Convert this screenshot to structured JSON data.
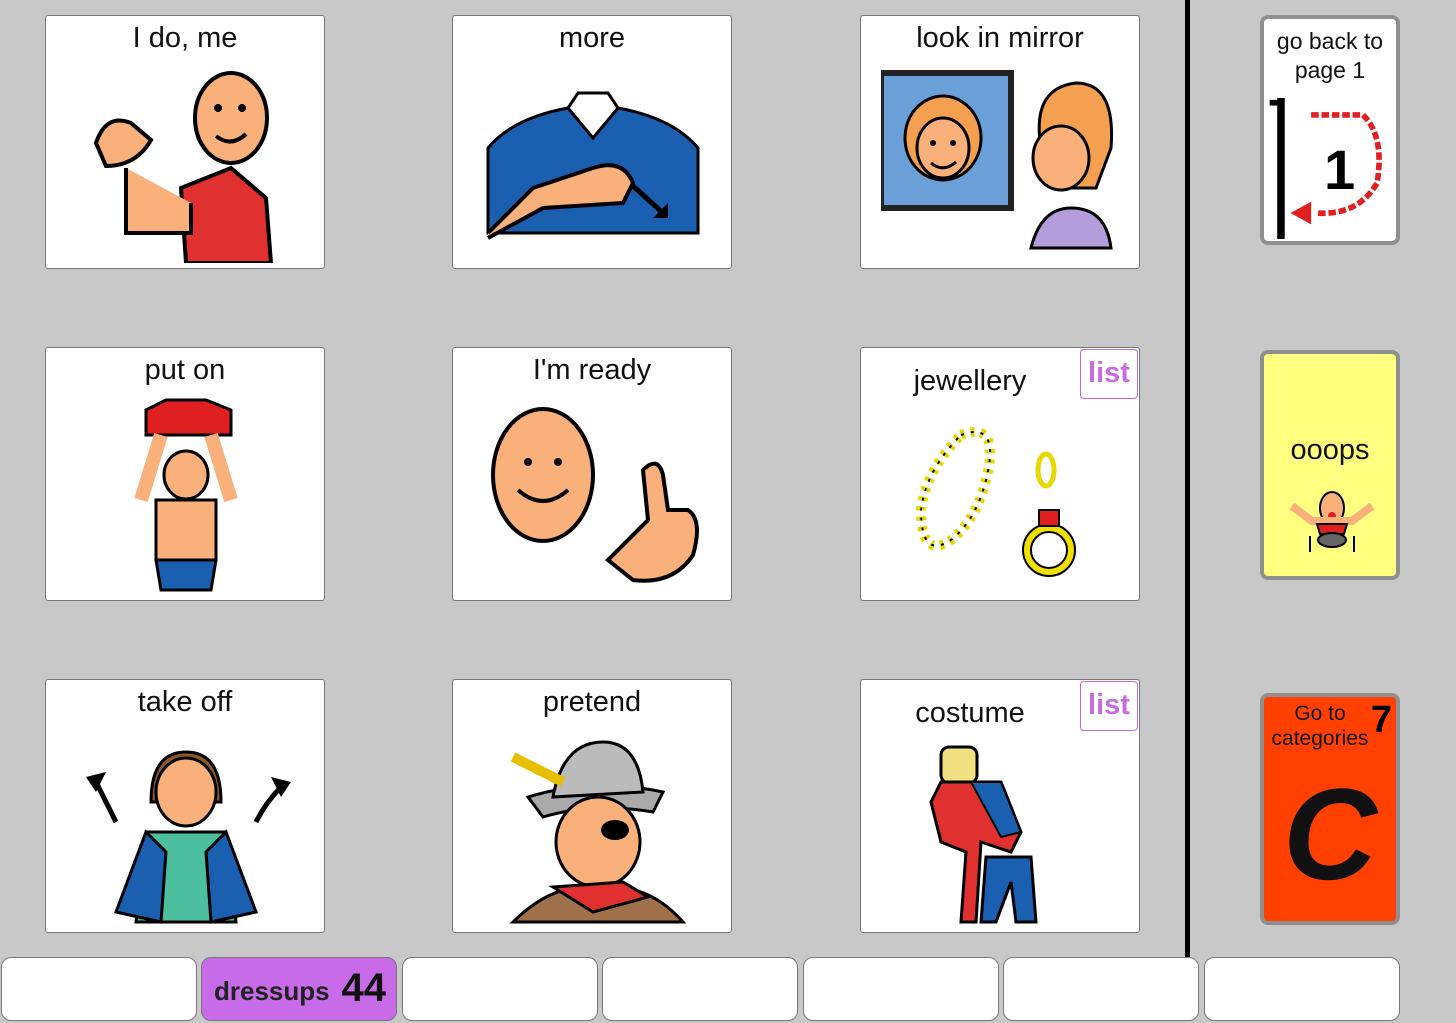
{
  "grid": [
    {
      "label": "I do, me",
      "list": ""
    },
    {
      "label": "more",
      "list": ""
    },
    {
      "label": "look in mirror",
      "list": ""
    },
    {
      "label": "put on",
      "list": ""
    },
    {
      "label": "I'm ready",
      "list": ""
    },
    {
      "label": "jewellery",
      "list": "list"
    },
    {
      "label": "take off",
      "list": ""
    },
    {
      "label": "pretend",
      "list": ""
    },
    {
      "label": "costume",
      "list": "list"
    }
  ],
  "side": {
    "back": {
      "label": "go back to page 1",
      "number": "1"
    },
    "oops": {
      "label": "ooops",
      "color": "#ffff80"
    },
    "categories": {
      "label": "Go to categories",
      "number": "7",
      "letter": "C",
      "color": "#ff4000"
    }
  },
  "bottom_tabs": [
    {
      "label": "",
      "count": ""
    },
    {
      "label": "dressups",
      "count": "44"
    },
    {
      "label": "",
      "count": ""
    },
    {
      "label": "",
      "count": ""
    },
    {
      "label": "",
      "count": ""
    },
    {
      "label": "",
      "count": ""
    },
    {
      "label": "",
      "count": ""
    }
  ],
  "icons": [
    "thumb-self-icon",
    "more-sign-icon",
    "mirror-icon",
    "shirt-on-icon",
    "ready-thumb-icon",
    "jewellery-icon",
    "jacket-off-icon",
    "pirate-icon",
    "costume-icon"
  ],
  "colors": {
    "background": "#c8c8c8",
    "active_tab": "#c86be8",
    "list_tag": "#c76be0"
  }
}
